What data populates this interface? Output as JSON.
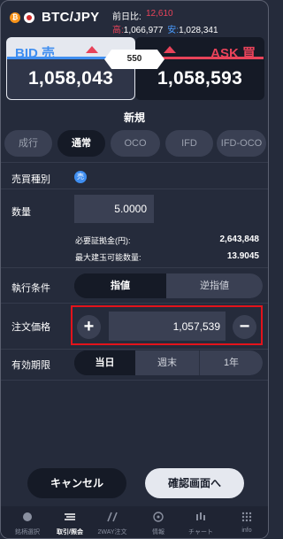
{
  "header": {
    "pair": "BTC/JPY",
    "btc_icon_glyph": "₿",
    "change_label": "前日比:",
    "change_value": "12,610",
    "high_label": "高:",
    "high_value": "1,066,977",
    "low_label": "安:",
    "low_value": "1,028,341"
  },
  "quote": {
    "bid_label": "BID 売",
    "bid_price": "1,058,043",
    "ask_label": "ASK 買",
    "ask_price": "1,058,593",
    "spread": "550"
  },
  "section_title": "新規",
  "order_tabs": [
    "成行",
    "通常",
    "OCO",
    "IFD",
    "IFD-OCO"
  ],
  "active_tab": "通常",
  "form": {
    "side_label": "売買種別",
    "side_badge": "売",
    "qty_label": "数量",
    "qty_value": "5.0000",
    "margin_label": "必要証拠金(円):",
    "margin_value": "2,643,848",
    "maxqty_label": "最大建玉可能数量:",
    "maxqty_value": "13.9045",
    "exec_label": "執行条件",
    "exec_options": [
      "指値",
      "逆指値"
    ],
    "price_label": "注文価格",
    "price_value": "1,057,539",
    "plus_glyph": "+",
    "minus_glyph": "−",
    "expiry_label": "有効期限",
    "expiry_options": [
      "当日",
      "週末",
      "1年"
    ]
  },
  "buttons": {
    "cancel": "キャンセル",
    "confirm": "確認画面へ"
  },
  "nav": [
    "銘柄選択",
    "取引/照会",
    "2WAY注文",
    "情報",
    "チャート",
    "info"
  ],
  "colors": {
    "bid": "#3f8ef0",
    "ask": "#e8435a",
    "highlight_border": "#e3131b"
  }
}
